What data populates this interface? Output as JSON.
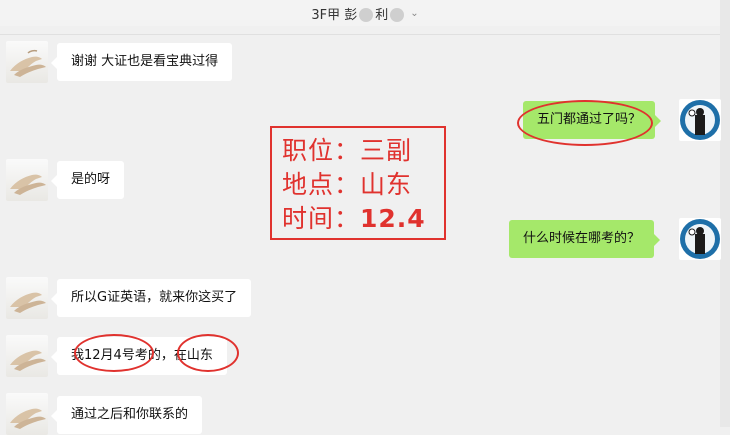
{
  "header": {
    "title_a": "3F甲 彭",
    "title_b": "利",
    "chevron": "⌄"
  },
  "messages": [
    {
      "side": "left",
      "text": "谢谢  大证也是看宝典过得"
    },
    {
      "side": "right",
      "text": "五门都通过了吗？"
    },
    {
      "side": "left",
      "text": "是的呀"
    },
    {
      "side": "right",
      "text": "什么时候在哪考的？"
    },
    {
      "side": "left",
      "text": "所以G证英语，就来你这买了"
    },
    {
      "side": "left",
      "text": "我12月4号考的，在山东"
    },
    {
      "side": "left",
      "text": "通过之后和你联系的"
    }
  ],
  "annotation": {
    "line1_label": "职位：",
    "line1_value": "三副",
    "line2_label": "地点：",
    "line2_value": "山东",
    "line3_label": "时间：",
    "line3_value": "12.4",
    "color": "#e0322e"
  },
  "colors": {
    "background": "#f0f0f0",
    "bubble_left": "#ffffff",
    "bubble_right": "#a5e86a"
  }
}
